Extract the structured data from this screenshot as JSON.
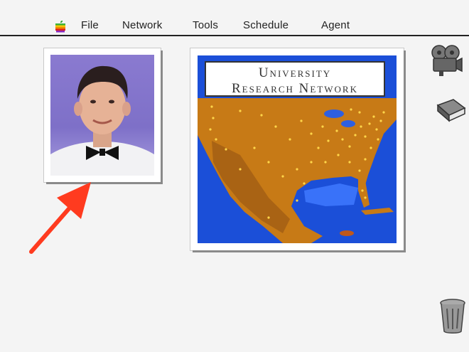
{
  "menubar": {
    "items": [
      "File",
      "Network",
      "Tools",
      "Schedule",
      "Agent"
    ]
  },
  "map_window": {
    "title_line1": "University",
    "title_line2": "Research Network"
  },
  "icons": {
    "apple": "apple-logo-icon",
    "camera": "film-camera-icon",
    "book": "book-icon",
    "trash": "trash-can-icon"
  },
  "colors": {
    "accent_arrow": "#ff3b1f",
    "land": "#c77a16",
    "ocean": "#1b4fd8",
    "photo_bg": "#8a7ad0"
  }
}
